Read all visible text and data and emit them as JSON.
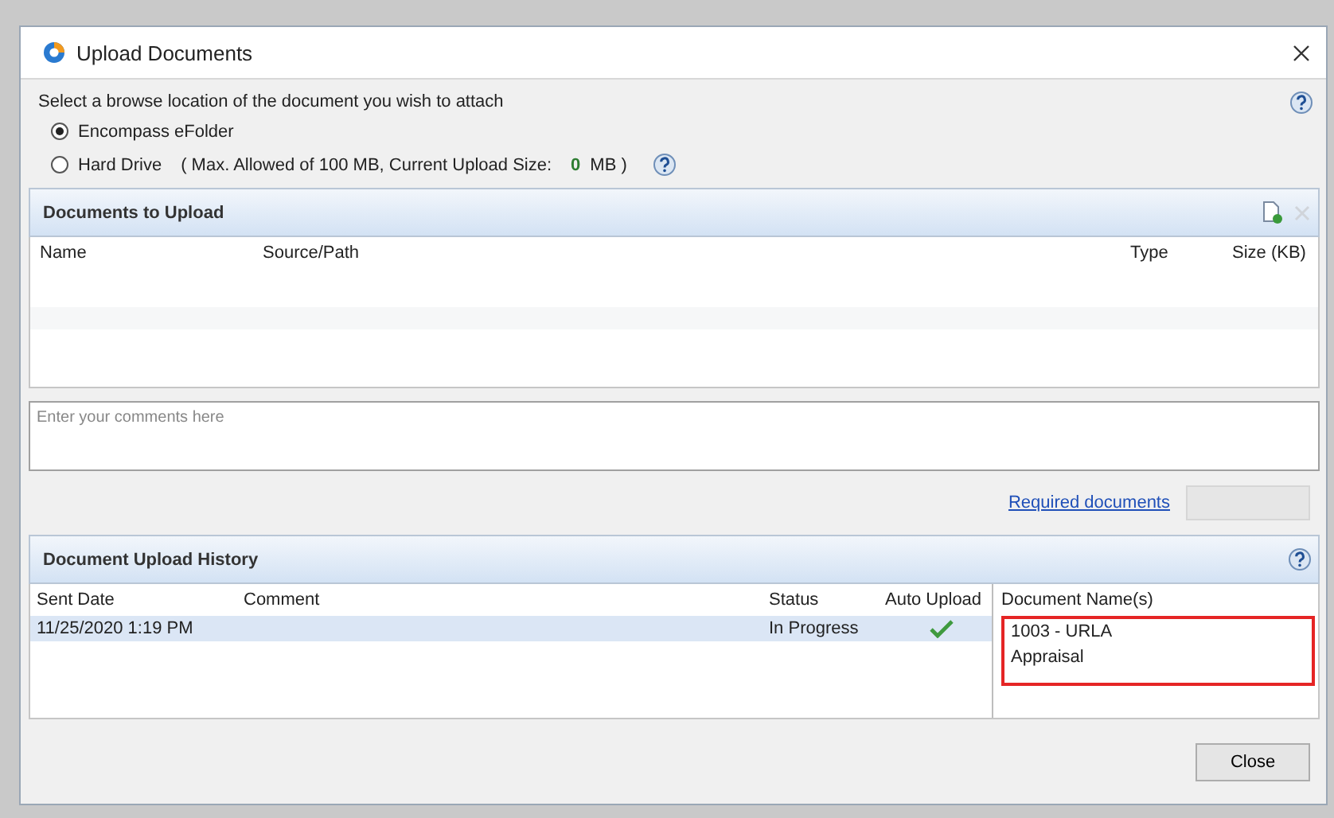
{
  "window": {
    "title": "Upload Documents"
  },
  "browse": {
    "prompt": "Select a browse location of the document you wish to attach",
    "options": [
      {
        "label": "Encompass eFolder",
        "selected": true
      },
      {
        "label": "Hard Drive",
        "selected": false,
        "note": "( Max. Allowed of 100 MB, Current Upload Size:",
        "size": "0",
        "unit": "MB )"
      }
    ]
  },
  "documents_to_upload": {
    "title": "Documents to Upload",
    "columns": [
      "Name",
      "Source/Path",
      "Type",
      "Size (KB)"
    ]
  },
  "comment": {
    "placeholder": "Enter your comments here"
  },
  "required_documents_link": "Required documents",
  "upload_button": {
    "disabled": true
  },
  "history": {
    "title": "Document Upload History",
    "columns": [
      "Sent Date",
      "Comment",
      "Status",
      "Auto Upload",
      "Document Name(s)"
    ],
    "rows": [
      {
        "sent_date": "11/25/2020 1:19 PM",
        "status": "In Progress",
        "auto_upload": true,
        "selected": true,
        "document_names": [
          "1003 - URLA",
          "Appraisal"
        ],
        "highlighted": true
      }
    ]
  },
  "buttons": [
    "Close"
  ]
}
